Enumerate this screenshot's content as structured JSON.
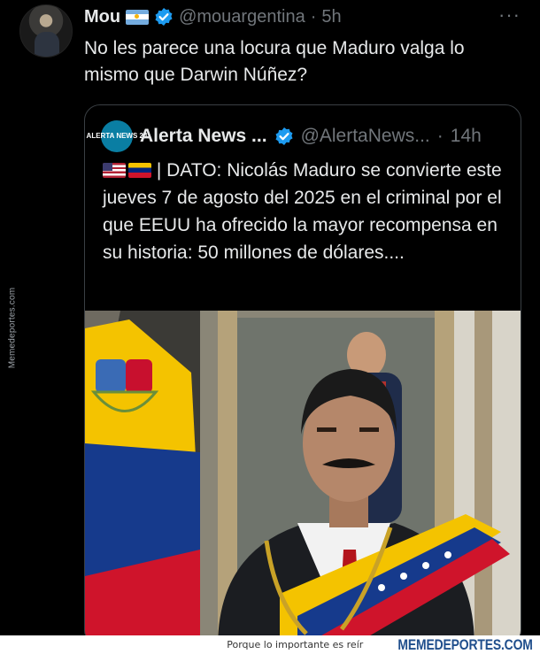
{
  "watermark": {
    "side": "Memedeportes.com"
  },
  "tweet": {
    "display_name": "Mou",
    "handle": "@mouargentina",
    "separator": "·",
    "time": "5h",
    "more": "···",
    "text": "No les parece una locura que Maduro valga lo mismo que Darwin Núñez?"
  },
  "quoted": {
    "avatar_text": "ALERTA NEWS 24",
    "display_name": "Alerta News ...",
    "handle": "@AlertaNews...",
    "separator": "·",
    "time": "14h",
    "text": "| DATO: Nicolás Maduro se convierte este jueves 7 de agosto del 2025 en el criminal por el que EEUU ha ofrecido la mayor recompensa en su historia: 50 millones de dólares...."
  },
  "footer": {
    "tagline": "Porque lo importante es reír",
    "site": "MEMEDEPORTES.COM"
  },
  "colors": {
    "background": "#000000",
    "text": "#e7e9ea",
    "muted": "#71767b",
    "verified": "#1d9bf0",
    "border": "#3a3f44",
    "footer_site": "#1f4e8c"
  },
  "icons": [
    "verified-badge-icon",
    "more-options-icon",
    "flag-argentina-icon",
    "flag-usa-icon",
    "flag-venezuela-icon"
  ]
}
